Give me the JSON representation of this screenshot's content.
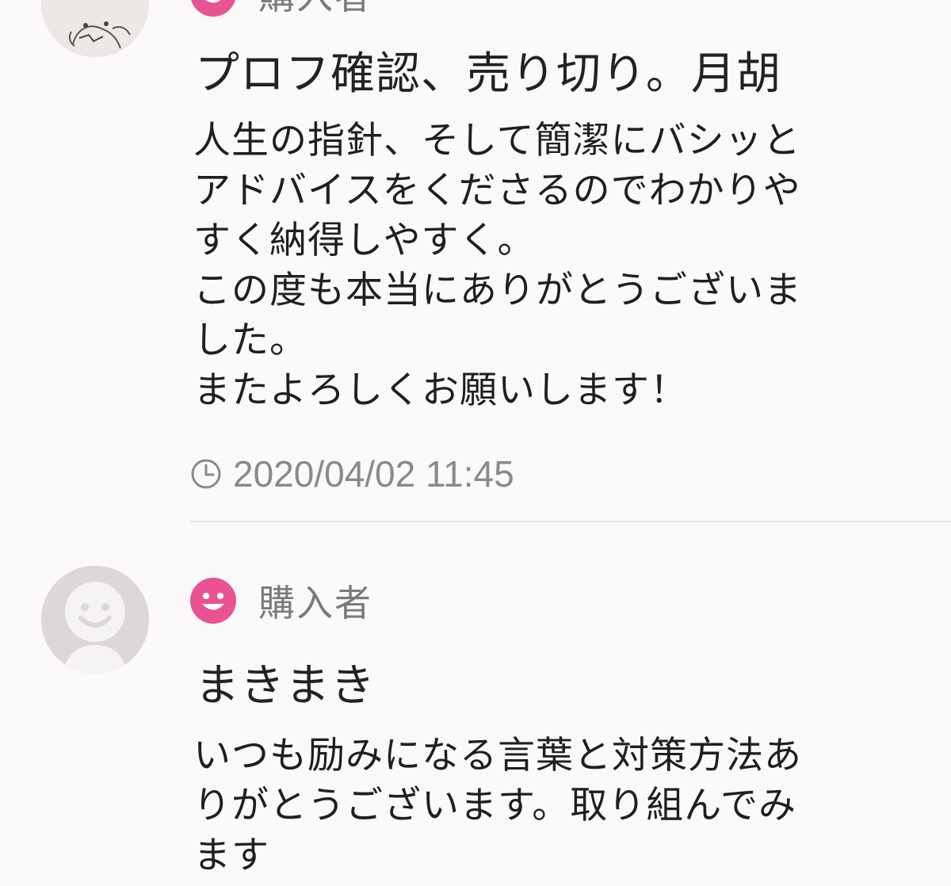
{
  "reviews": [
    {
      "role": "購入者",
      "title": "プロフ確認、売り切り。月胡",
      "body": "人生の指針、そして簡潔にバシッと\nアドバイスをくださるのでわかりや\nすく納得しやすく。\nこの度も本当にありがとうございま\nした。\nまたよろしくお願いします！",
      "timestamp": "2020/04/02 11:45",
      "avatar": "sketch-avatar"
    },
    {
      "role": "購入者",
      "title": "まきまき",
      "body": "いつも励みになる言葉と対策方法あ\nりがとうございます。取り組んでみ\nます",
      "avatar": "default-avatar"
    }
  ],
  "colors": {
    "background": "#fcf9fa",
    "role_icon": "#e95391",
    "muted_text": "#7a7a7a",
    "default_avatar_bg": "#dcd8d9",
    "default_avatar_fg": "#f5f3f4"
  },
  "icons": {
    "role": "smiley-face-icon",
    "time": "clock-icon"
  }
}
